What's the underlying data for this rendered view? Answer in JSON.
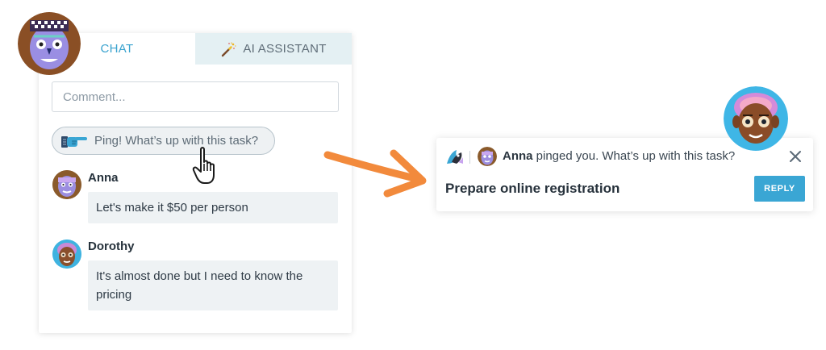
{
  "tabs": {
    "chat_label": "CHAT",
    "ai_label": "AI ASSISTANT"
  },
  "comment": {
    "placeholder": "Comment..."
  },
  "ping": {
    "label": "Ping! What’s up with this task?",
    "icon": "pointing-hand-icon"
  },
  "messages": [
    {
      "author": "Anna",
      "text": "Let's make it $50 per person"
    },
    {
      "author": "Dorothy",
      "text": "It's almost done but I need to know the pricing"
    }
  ],
  "notification": {
    "sender": "Anna",
    "message": " pinged you. What’s up with this task?",
    "task": "Prepare online registration",
    "reply_label": "REPLY"
  },
  "colors": {
    "accent": "#3aa6d4",
    "arrow": "#f28a3c",
    "tab_inactive_bg": "#e4f0f3"
  }
}
